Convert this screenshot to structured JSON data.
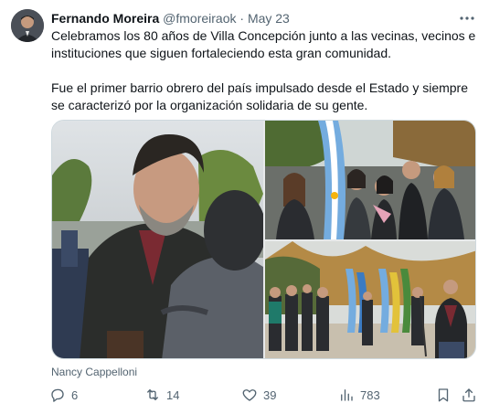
{
  "author": {
    "name": "Fernando Moreira",
    "handle": "@fmoreiraok",
    "separator": "·",
    "date": "May 23"
  },
  "tweet": {
    "paragraph1": "Celebramos los 80 años de Villa Concepción junto a las vecinas, vecinos e instituciones que siguen fortaleciendo esta gran comunidad.",
    "paragraph2": "Fue el primer barrio obrero del país impulsado desde el Estado y siempre se caracterizó por la organización solidaria de su gente."
  },
  "media": {
    "photo_credit": "Nancy Cappelloni",
    "photos": [
      "photo-man-greeting-person",
      "photo-group-with-flag",
      "photo-outdoor-ceremony-flags"
    ]
  },
  "actions": {
    "replies": "6",
    "retweets": "14",
    "likes": "39",
    "views": "783"
  },
  "icons": {
    "more": "more-dots-icon",
    "reply": "reply-icon",
    "retweet": "retweet-icon",
    "like": "heart-icon",
    "views": "views-icon",
    "bookmark": "bookmark-icon",
    "share": "share-icon"
  },
  "colors": {
    "text": "#0f1419",
    "secondary": "#536471",
    "border": "#cfd9de",
    "flag_blue": "#74acdf"
  }
}
